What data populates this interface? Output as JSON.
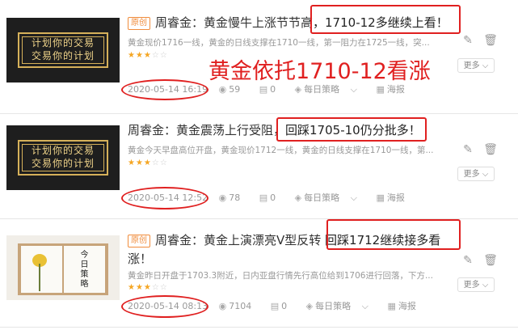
{
  "annotation_text": "黄金依托1710-12看涨",
  "more_label": "更多",
  "articles": [
    {
      "tag": "原创",
      "title_prefix": "周睿金：黄金慢牛上涨节节高",
      "title_highlight": "，1710-12多继续上看！",
      "summary": "黄金现价1716一线，黄金的日线支撑在1710一线，第一阻力在1725一线，突...",
      "stars_filled": "★★★",
      "stars_empty": "☆☆",
      "datetime": "2020-05-14 16:19",
      "views": "59",
      "comments": "0",
      "category": "每日策略",
      "poster": "海报",
      "thumb_text_1": "计划你的交易",
      "thumb_text_2": "交易你的计划"
    },
    {
      "tag": "",
      "title_prefix": "周睿金：黄金震荡上行受阻，",
      "title_highlight": "回踩1705-10仍分批多！",
      "summary": "黄金今天早盘高位开盘，黄金现价1712一线，黄金的日线支撑在1710一线，第...",
      "stars_filled": "★★★",
      "stars_empty": "☆☆",
      "datetime": "2020-05-14 12:52",
      "views": "78",
      "comments": "0",
      "category": "每日策略",
      "poster": "海报",
      "thumb_text_1": "计划你的交易",
      "thumb_text_2": "交易你的计划"
    },
    {
      "tag": "原创",
      "title_prefix": "周睿金：黄金上演漂亮V型反转",
      "title_highlight": "回踩1712继续接多看",
      "title_line2": "涨！",
      "summary": "黄金昨日开盘于1703.3附近，日内亚盘行情先行高位给到1706进行回落，下方...",
      "stars_filled": "★★★",
      "stars_empty": "☆☆",
      "datetime": "2020-05-14 08:13",
      "views": "7104",
      "comments": "0",
      "category": "每日策略",
      "poster": "海报",
      "thumb_text": "今日策略"
    }
  ]
}
